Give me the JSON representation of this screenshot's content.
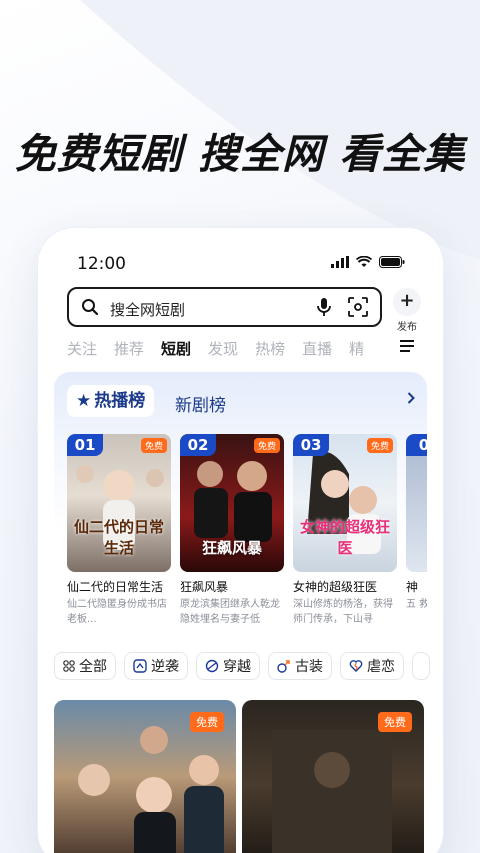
{
  "headline": "免费短剧 搜全网 看全集",
  "status_bar": {
    "time": "12:00"
  },
  "search": {
    "placeholder": "搜全网短剧"
  },
  "publish_label": "发布",
  "nav_tabs": [
    "关注",
    "推荐",
    "短剧",
    "发现",
    "热榜",
    "直播",
    "精"
  ],
  "active_tab": "短剧",
  "rank": {
    "tabs": [
      "热播榜",
      "新剧榜"
    ],
    "items": [
      {
        "rank": "01",
        "badge": "免费",
        "poster_text": "仙二代的日常生活",
        "title": "仙二代的日常生活",
        "desc": "仙二代隐匿身份成书店老板..."
      },
      {
        "rank": "02",
        "badge": "免费",
        "poster_text": "狂飙风暴",
        "title": "狂飙风暴",
        "desc": "原龙滨集团继承人乾龙隐姓埋名与妻子低"
      },
      {
        "rank": "03",
        "badge": "免费",
        "poster_text": "女神的超级狂医",
        "title": "女神的超级狂医",
        "desc": "深山修炼的杨洛，获得师门传承，下山寻"
      },
      {
        "rank": "0",
        "badge": "",
        "poster_text": "",
        "title": "神",
        "desc": "五 救"
      }
    ]
  },
  "genres": [
    "全部",
    "逆袭",
    "穿越",
    "古装",
    "虐恋",
    ""
  ],
  "feed": [
    {
      "badge": "免费"
    },
    {
      "badge": "免费"
    }
  ],
  "colors": {
    "accent": "#1b4ac6",
    "badge": "#ff6b1a",
    "rank_text": "#1c3a8a"
  }
}
